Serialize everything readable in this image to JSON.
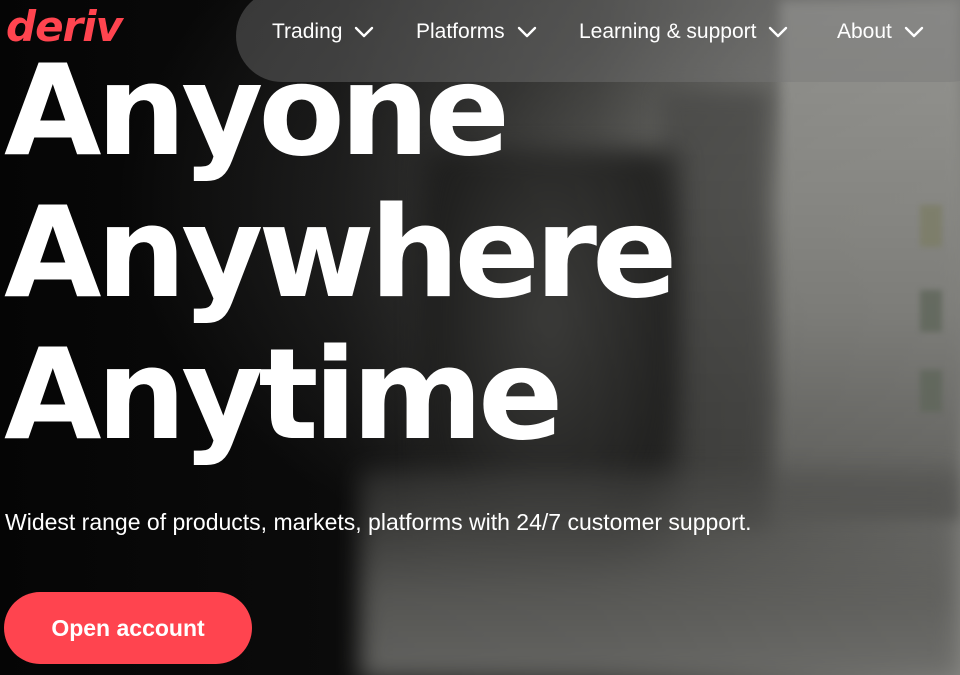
{
  "brand": {
    "logo_text": "deriv",
    "accent_color": "#ff444f"
  },
  "nav": {
    "items": [
      {
        "label": "Trading",
        "icon": "chevron-down-icon"
      },
      {
        "label": "Platforms",
        "icon": "chevron-down-icon"
      },
      {
        "label": "Learning & support",
        "icon": "chevron-down-icon"
      },
      {
        "label": "About",
        "icon": "chevron-down-icon"
      }
    ]
  },
  "hero": {
    "headline": [
      "Anyone",
      "Anywhere",
      "Anytime"
    ],
    "subtitle": "Widest range of products, markets, platforms with 24/7 customer support.",
    "cta_label": "Open account"
  }
}
